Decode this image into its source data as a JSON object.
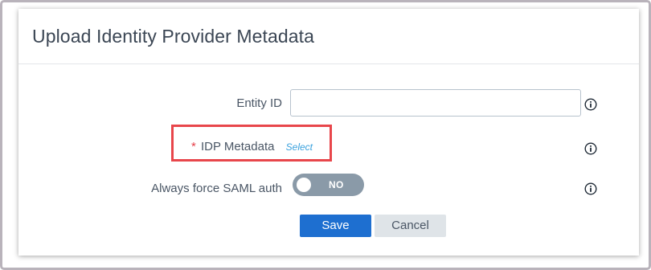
{
  "dialog": {
    "title": "Upload Identity Provider Metadata"
  },
  "form": {
    "entity_id": {
      "label": "Entity ID",
      "value": "",
      "placeholder": ""
    },
    "idp_metadata": {
      "required_mark": "*",
      "label": "IDP Metadata",
      "select_link": "Select"
    },
    "force_saml": {
      "label": "Always force SAML auth",
      "toggle_text": "NO"
    }
  },
  "buttons": {
    "save": "Save",
    "cancel": "Cancel"
  },
  "colors": {
    "primary": "#1e6fd0",
    "link": "#3aa1dd",
    "required": "#e5414a",
    "highlight": "#e8464b",
    "toggle_off": "#8a9aa8"
  },
  "icons": [
    "info-icon",
    "info-icon",
    "info-icon"
  ]
}
